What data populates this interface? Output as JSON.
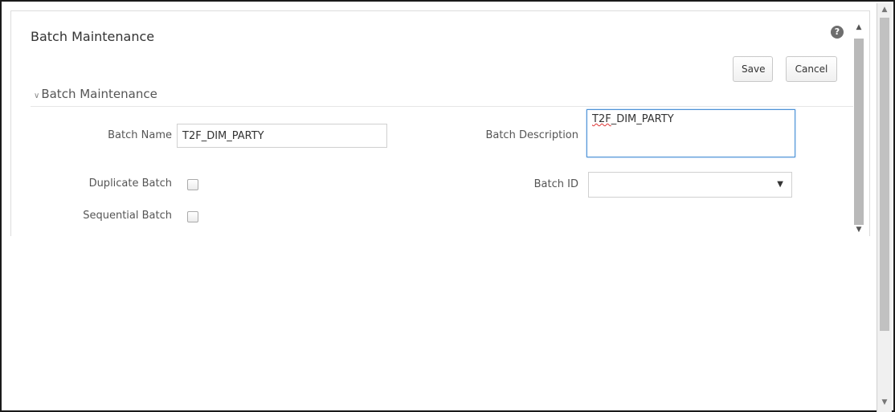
{
  "page": {
    "title": "Batch Maintenance",
    "help_icon": "?"
  },
  "toolbar": {
    "save_label": "Save",
    "cancel_label": "Cancel"
  },
  "section": {
    "title": "Batch Maintenance",
    "chevron": "∨"
  },
  "form": {
    "batch_name_label": "Batch Name",
    "batch_name_value": "T2F_DIM_PARTY",
    "batch_description_label": "Batch Description",
    "batch_description_prefix": "T2F",
    "batch_description_rest": "_DIM_PARTY",
    "duplicate_batch_label": "Duplicate Batch",
    "batch_id_label": "Batch ID",
    "batch_id_value": "",
    "sequential_batch_label": "Sequential Batch"
  },
  "icons": {
    "help": "help-icon",
    "section_toggle": "chevron-down-icon",
    "dropdown": "caret-down-icon",
    "scroll_up": "arrow-up-icon",
    "scroll_down": "arrow-down-icon"
  },
  "glyphs": {
    "caret_down": "▼",
    "caret_up": "▲"
  },
  "colors": {
    "focus_border": "#4a90d6",
    "frame_border": "#1a1a1a"
  }
}
